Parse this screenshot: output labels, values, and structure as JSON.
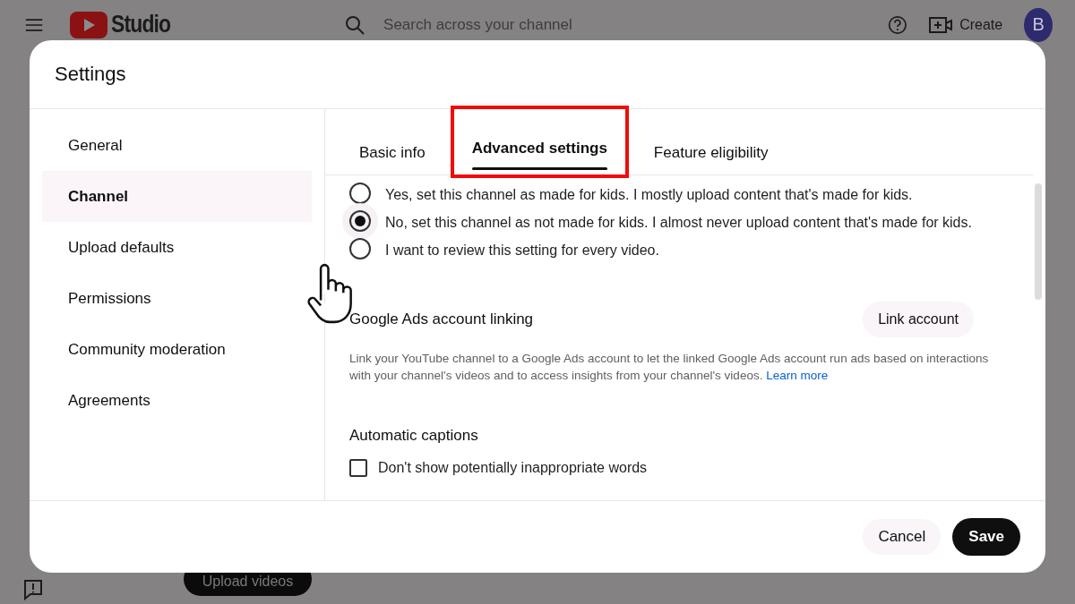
{
  "header": {
    "logo_text": "Studio",
    "search": {
      "placeholder": "Search across your channel"
    },
    "create_label": "Create",
    "avatar_letter": "B"
  },
  "background": {
    "upload_button": "Upload videos"
  },
  "dialog": {
    "title": "Settings",
    "nav": [
      {
        "label": "General",
        "selected": false
      },
      {
        "label": "Channel",
        "selected": true
      },
      {
        "label": "Upload defaults",
        "selected": false
      },
      {
        "label": "Permissions",
        "selected": false
      },
      {
        "label": "Community moderation",
        "selected": false
      },
      {
        "label": "Agreements",
        "selected": false
      }
    ],
    "tabs": [
      {
        "label": "Basic info",
        "selected": false,
        "highlighted": false
      },
      {
        "label": "Advanced settings",
        "selected": true,
        "highlighted": true
      },
      {
        "label": "Feature eligibility",
        "selected": false,
        "highlighted": false
      }
    ],
    "audience_options": [
      {
        "label": "Yes, set this channel as made for kids. I mostly upload content that's made for kids.",
        "selected": false
      },
      {
        "label": "No, set this channel as not made for kids. I almost never upload content that's made for kids.",
        "selected": true
      },
      {
        "label": "I want to review this setting for every video.",
        "selected": false
      }
    ],
    "ads": {
      "title": "Google Ads account linking",
      "button": "Link account",
      "description": "Link your YouTube channel to a Google Ads account to let the linked Google Ads account run ads based on interactions with your channel's videos and to access insights from your channel's videos.",
      "link": "Learn more"
    },
    "captions": {
      "title": "Automatic captions",
      "checkbox": {
        "label": "Don't show potentially inappropriate words",
        "checked": false
      }
    },
    "buttons": {
      "cancel": "Cancel",
      "save": "Save"
    }
  }
}
